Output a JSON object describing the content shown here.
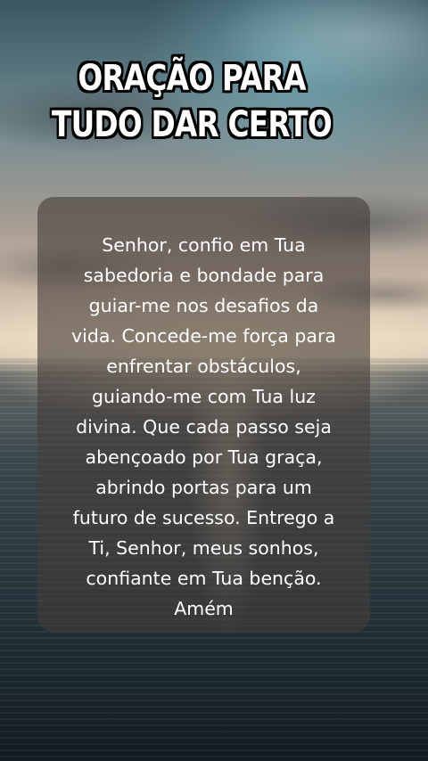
{
  "title": {
    "line1": "ORAÇÃO PARA",
    "line2": "TUDO DAR CERTO"
  },
  "prayer": {
    "lines": [
      "Senhor, confio em Tua",
      "sabedoria e bondade para",
      "guiar-me nos desafios da",
      "vida. Concede-me força para",
      "enfrentar obstáculos,",
      "guiando-me com Tua luz",
      "divina. Que cada passo seja",
      "abençoado por Tua graça,",
      "abrindo portas para um",
      "futuro de sucesso. Entrego a",
      "Ti, Senhor, meus sonhos,",
      "confiante em Tua benção.",
      "Amém"
    ]
  },
  "colors": {
    "text": "#ffffff",
    "title_outline": "#000000",
    "card_background": "rgba(70,62,58,0.62)"
  }
}
